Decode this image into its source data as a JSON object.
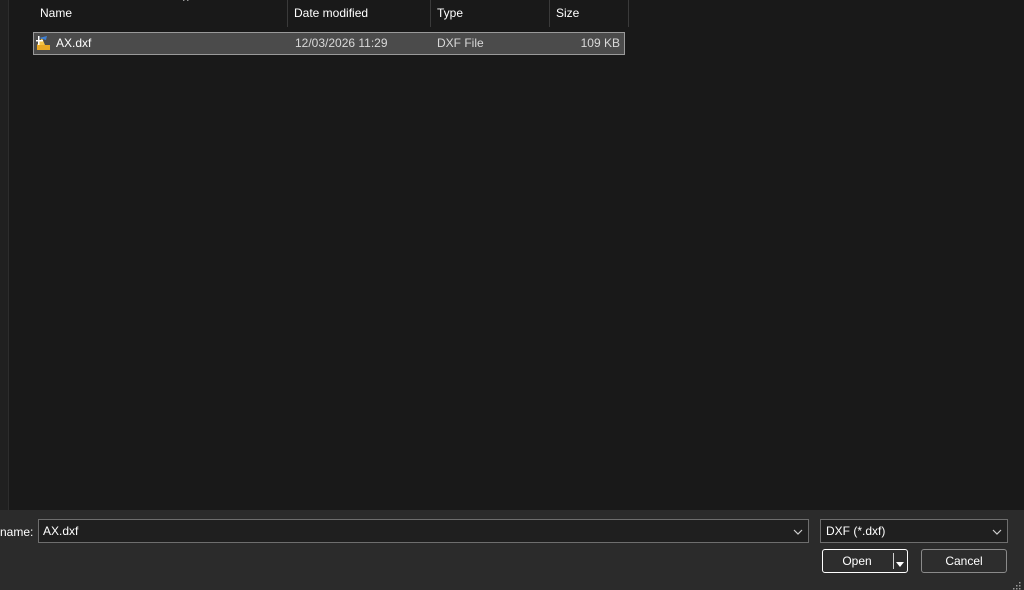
{
  "columns": {
    "name": "Name",
    "date_modified": "Date modified",
    "type": "Type",
    "size": "Size"
  },
  "sort_indicator": "^",
  "files": [
    {
      "name": "AX.dxf",
      "date_modified": "12/03/2026 11:29",
      "type": "DXF File",
      "size": "109 KB",
      "icon": "dxf-file-icon"
    }
  ],
  "footer": {
    "file_name_label": "name:",
    "file_name_value": "AX.dxf",
    "file_type_value": "DXF (*.dxf)",
    "open_label": "Open",
    "cancel_label": "Cancel"
  },
  "colors": {
    "background": "#191919",
    "footer": "#2b2b2b",
    "selection": "#4b4b4b"
  }
}
